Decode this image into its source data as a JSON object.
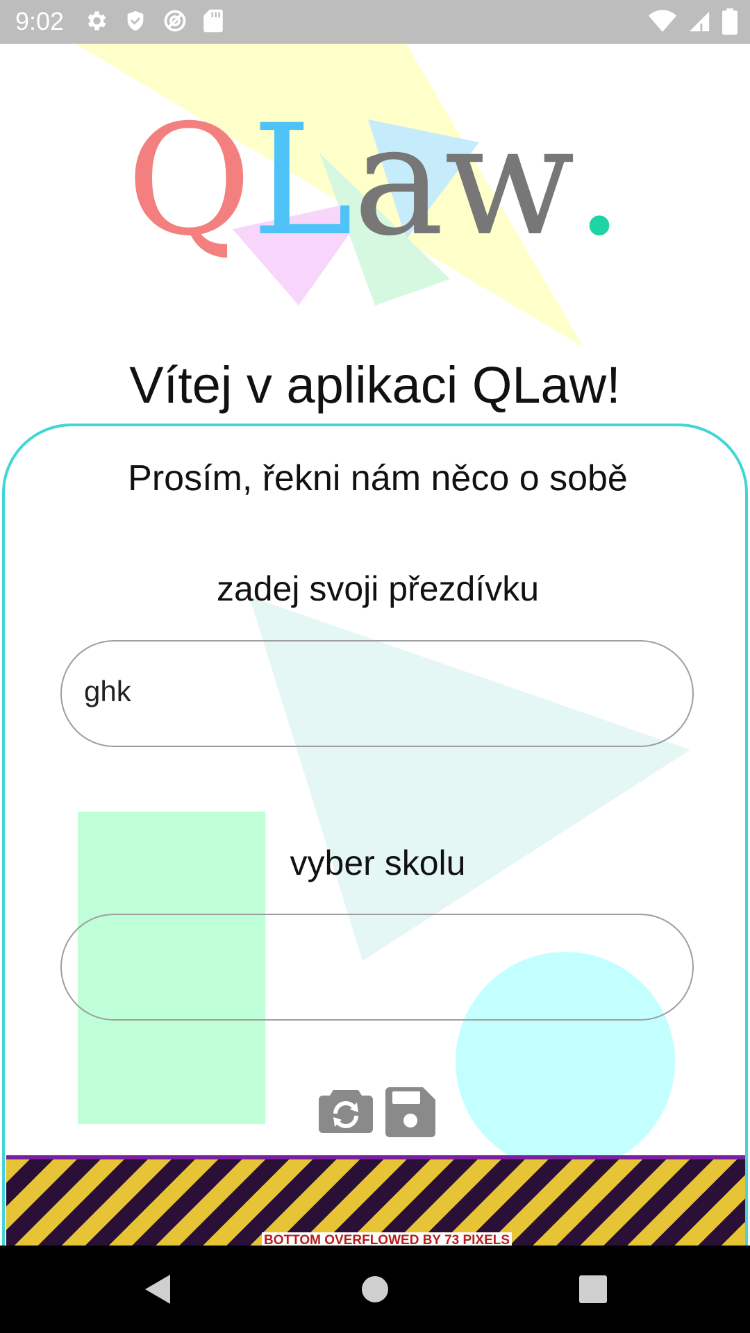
{
  "status_bar": {
    "time": "9:02",
    "left_icons": [
      "gear-icon",
      "shield-icon",
      "at-circle-icon",
      "sd-card-icon"
    ],
    "right_icons": [
      "wifi-icon",
      "signal-icon",
      "battery-icon"
    ]
  },
  "logo": {
    "q": "Q",
    "l": "L",
    "aw": "aw",
    "dot": "."
  },
  "welcome_title": "Vítej v aplikaci QLaw!",
  "card": {
    "subtitle": "Prosím, řekni nám něco o sobě",
    "nickname_label": "zadej svoji přezdívku",
    "nickname_value": "ghk",
    "school_label": "vyber skolu",
    "school_value": "",
    "buttons": [
      "camera-switch-icon",
      "save-icon"
    ]
  },
  "overflow_warning": "BOTTOM OVERFLOWED BY 73 PIXELS",
  "colors": {
    "accent_border": "#40d6d6",
    "logo_q": "#f47f7f",
    "logo_l": "#4fc3f7",
    "logo_aw": "#777777",
    "logo_dot": "#1ed3a4",
    "status_bar": "#bdbdbd"
  },
  "nav_bar": {
    "buttons": [
      "back-icon",
      "home-icon",
      "recents-icon"
    ]
  }
}
